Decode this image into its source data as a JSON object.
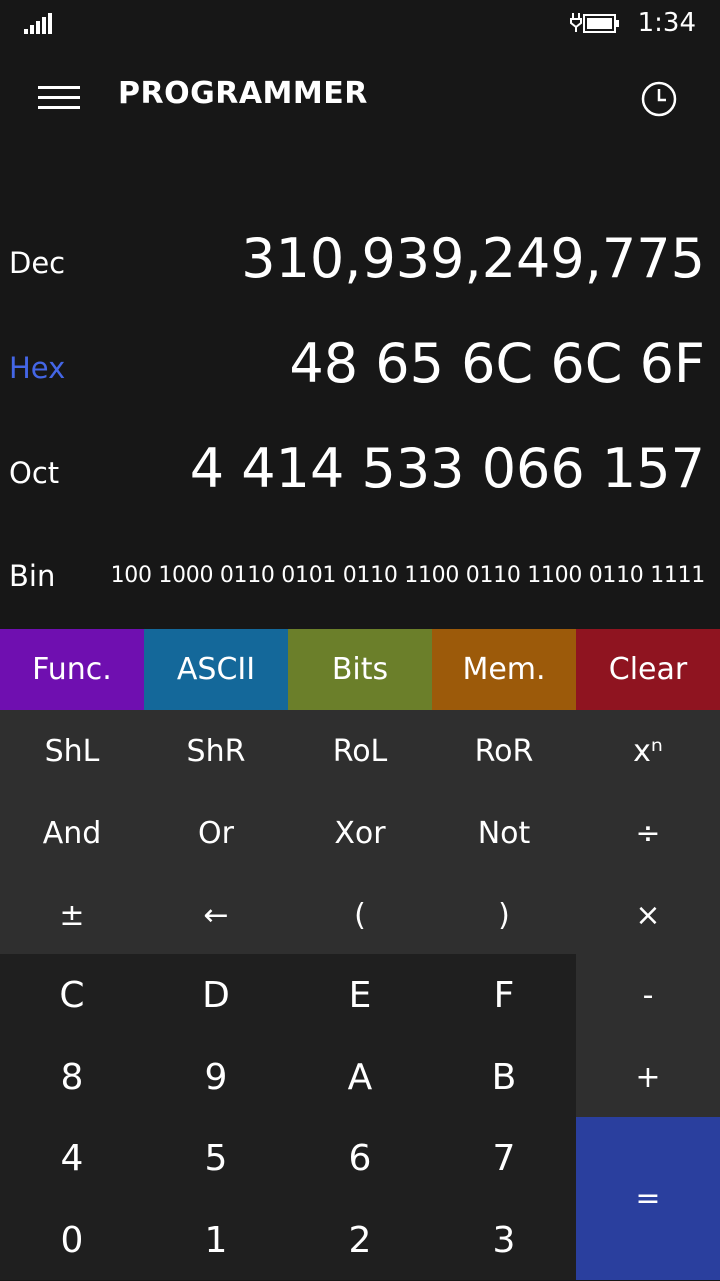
{
  "status": {
    "time": "1:34"
  },
  "header": {
    "title": "PROGRAMMER"
  },
  "display": {
    "dec": {
      "label": "Dec",
      "value": "310,939,249,775"
    },
    "hex": {
      "label": "Hex",
      "value": "48 65 6C 6C 6F"
    },
    "oct": {
      "label": "Oct",
      "value": "4 414 533 066 157"
    },
    "bin": {
      "label": "Bin",
      "value": "100 1000 0110 0101 0110 1100 0110 1100 0110 1111"
    },
    "active_mode": "Hex",
    "active_color": "#4466e6"
  },
  "modes": [
    {
      "label": "Func.",
      "color": "#6f0fb0"
    },
    {
      "label": "ASCII",
      "color": "#14689a"
    },
    {
      "label": "Bits",
      "color": "#6b7f2a"
    },
    {
      "label": "Mem.",
      "color": "#9c5a0a"
    },
    {
      "label": "Clear",
      "color": "#8f1420"
    }
  ],
  "keys": {
    "r1": [
      "ShL",
      "ShR",
      "RoL",
      "RoR",
      "xⁿ"
    ],
    "r2": [
      "And",
      "Or",
      "Xor",
      "Not",
      "÷"
    ],
    "r3": [
      "±",
      "←",
      "(",
      ")",
      "×"
    ],
    "r4": [
      "C",
      "D",
      "E",
      "F",
      "-"
    ],
    "r5": [
      "8",
      "9",
      "A",
      "B",
      "+"
    ],
    "r6": [
      "4",
      "5",
      "6",
      "7"
    ],
    "r7": [
      "0",
      "1",
      "2",
      "3"
    ],
    "equals": "="
  },
  "icons": {
    "signal": "signal-icon",
    "battery": "battery-charging-icon",
    "menu": "hamburger-menu-icon",
    "history": "clock-history-icon"
  },
  "colors": {
    "background": "#171717",
    "function_keys_bg": "#2f2f2f",
    "digit_keys_bg": "#1f1f1f",
    "equals_bg": "#2a3f9e"
  }
}
